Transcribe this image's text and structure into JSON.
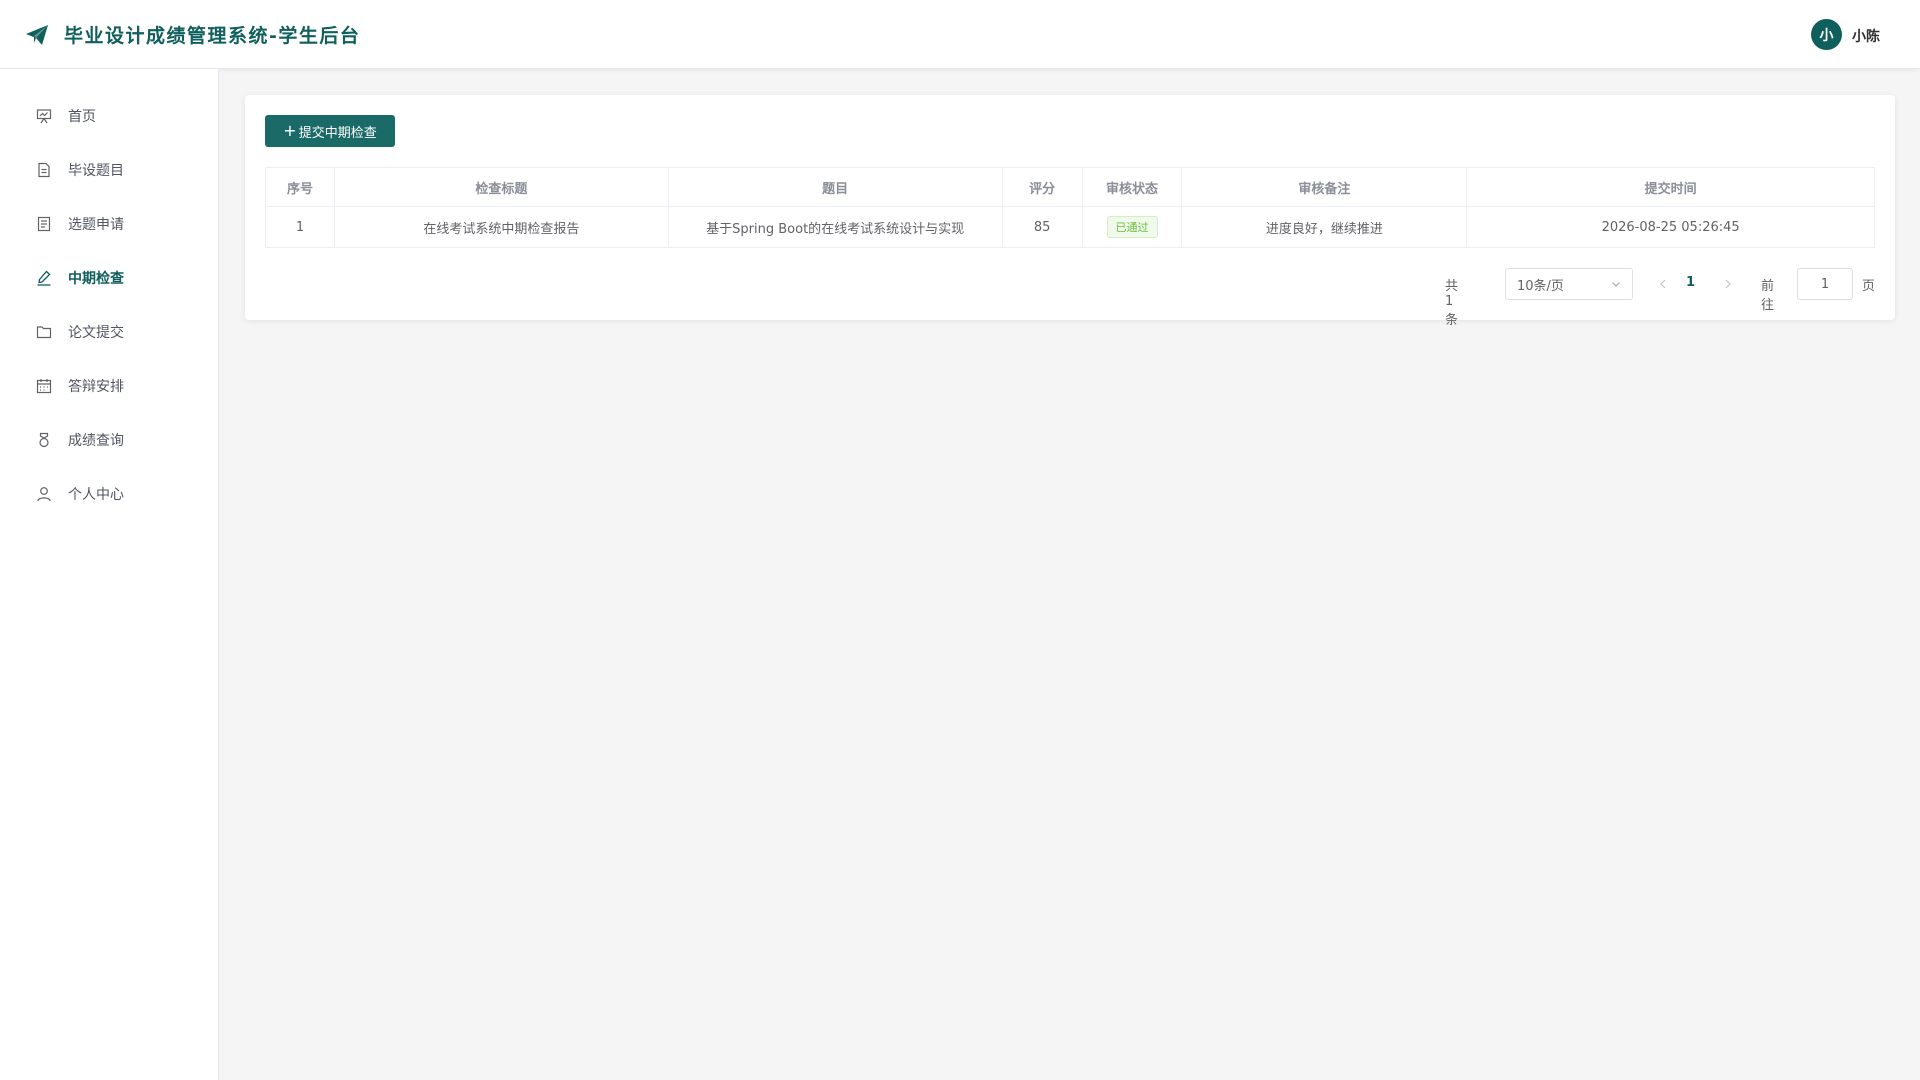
{
  "header": {
    "title": "毕业设计成绩管理系统-学生后台",
    "avatar_text": "小",
    "user_name": "小陈"
  },
  "sidebar": {
    "items": [
      {
        "label": "首页",
        "icon": "presentation-icon"
      },
      {
        "label": "毕设题目",
        "icon": "document-icon"
      },
      {
        "label": "选题申请",
        "icon": "list-document-icon"
      },
      {
        "label": "中期检查",
        "icon": "edit-pen-icon",
        "active": true
      },
      {
        "label": "论文提交",
        "icon": "folder-icon"
      },
      {
        "label": "答辩安排",
        "icon": "calendar-icon"
      },
      {
        "label": "成绩查询",
        "icon": "medal-icon"
      },
      {
        "label": "个人中心",
        "icon": "user-icon"
      }
    ]
  },
  "toolbar": {
    "submit_label": "提交中期检查"
  },
  "table": {
    "headers": [
      "序号",
      "检查标题",
      "题目",
      "评分",
      "审核状态",
      "审核备注",
      "提交时间"
    ],
    "rows": [
      {
        "index": "1",
        "check_title": "在线考试系统中期检查报告",
        "topic": "基于Spring Boot的在线考试系统设计与实现",
        "score": "85",
        "status": "已通过",
        "remark": "进度良好，继续推进",
        "submit_time": "2026-08-25 05:26:45"
      }
    ]
  },
  "pagination": {
    "total": "共 1 条",
    "page_size": "10条/页",
    "current_page": "1",
    "goto_label": "前往",
    "goto_value": "1",
    "page_suffix": "页"
  },
  "colors": {
    "brand": "#0f5f5c",
    "primary_button": "#1a6b68",
    "success": "#67c23a"
  }
}
